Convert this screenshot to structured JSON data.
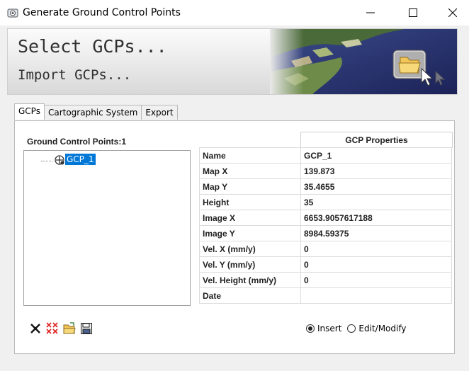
{
  "window": {
    "title": "Generate Ground Control Points",
    "minimize_glyph": "—",
    "maximize_glyph": "☐",
    "close_glyph": "✕"
  },
  "banner": {
    "select_link": "Select GCPs...",
    "import_link": "Import GCPs...",
    "art_icon": "folder-with-cursor-icon"
  },
  "tabs": [
    {
      "label": "GCPs",
      "active": true
    },
    {
      "label": "Cartographic System",
      "active": false
    },
    {
      "label": "Export",
      "active": false
    }
  ],
  "gcp_list": {
    "heading": "Ground Control Points:1",
    "items": [
      {
        "label": "GCP_1",
        "selected": true,
        "icon": "crosshair-point-icon"
      }
    ]
  },
  "properties": {
    "header": "GCP Properties",
    "rows": [
      {
        "key": "Name",
        "value": "GCP_1"
      },
      {
        "key": "Map X",
        "value": "139.873"
      },
      {
        "key": "Map Y",
        "value": "35.4655"
      },
      {
        "key": "Height",
        "value": "35"
      },
      {
        "key": "Image X",
        "value": "6653.9057617188"
      },
      {
        "key": "Image Y",
        "value": "8984.59375"
      },
      {
        "key": "Vel. X (mm/y)",
        "value": "0"
      },
      {
        "key": "Vel. Y (mm/y)",
        "value": "0"
      },
      {
        "key": "Vel. Height (mm/y)",
        "value": "0"
      },
      {
        "key": "Date",
        "value": ""
      }
    ]
  },
  "toolbar": {
    "buttons": [
      {
        "icon": "delete-icon"
      },
      {
        "icon": "delete-all-icon"
      },
      {
        "icon": "open-folder-icon"
      },
      {
        "icon": "save-icon"
      }
    ]
  },
  "mode": {
    "options": [
      {
        "label": "Insert",
        "checked": true
      },
      {
        "label": "Edit/Modify",
        "checked": false
      }
    ]
  },
  "colors": {
    "selection": "#0078d7",
    "window_bg": "#f0f0f0"
  }
}
